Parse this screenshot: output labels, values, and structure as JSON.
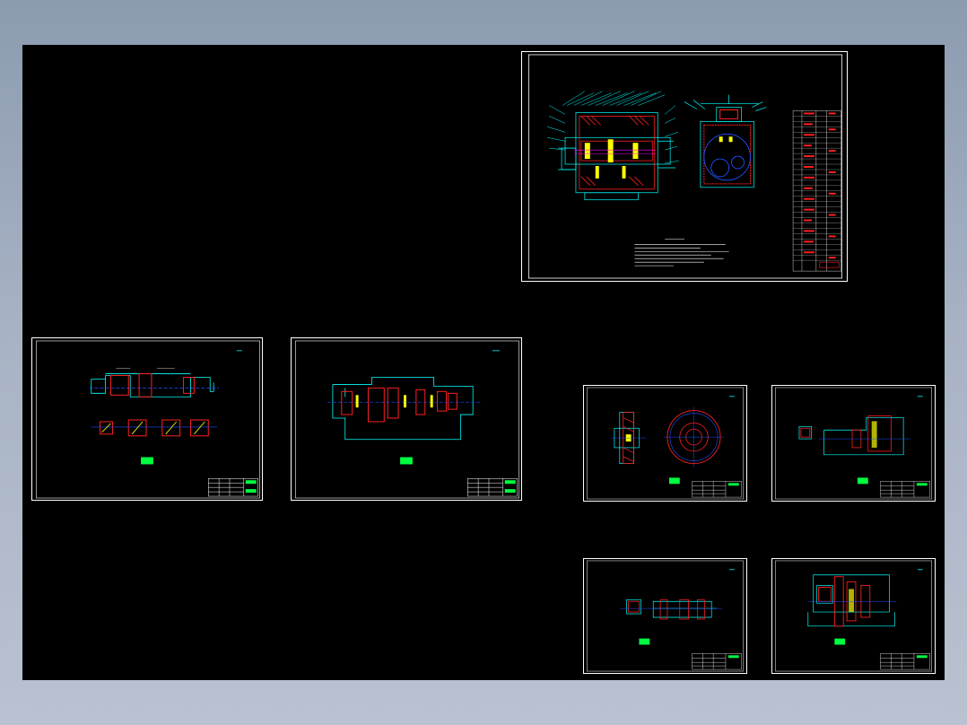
{
  "viewer": {
    "background_color": "#000000",
    "sheet_border_color": "#ffffff",
    "layer_colors": {
      "outline": "#00ffff",
      "section": "#ff2020",
      "accent": "#ffff00",
      "annotation": "#00ff40",
      "center": "#2050ff",
      "dimension": "#ff00ff"
    }
  },
  "sheets": [
    {
      "id": "assembly",
      "kind": "assembly-drawing"
    },
    {
      "id": "shaft-long",
      "kind": "part-drawing"
    },
    {
      "id": "shaft-stepped",
      "kind": "part-drawing"
    },
    {
      "id": "gear",
      "kind": "part-drawing"
    },
    {
      "id": "shaft-b",
      "kind": "part-drawing"
    },
    {
      "id": "shaft-c",
      "kind": "part-drawing"
    },
    {
      "id": "gear-shaft",
      "kind": "part-drawing"
    }
  ]
}
